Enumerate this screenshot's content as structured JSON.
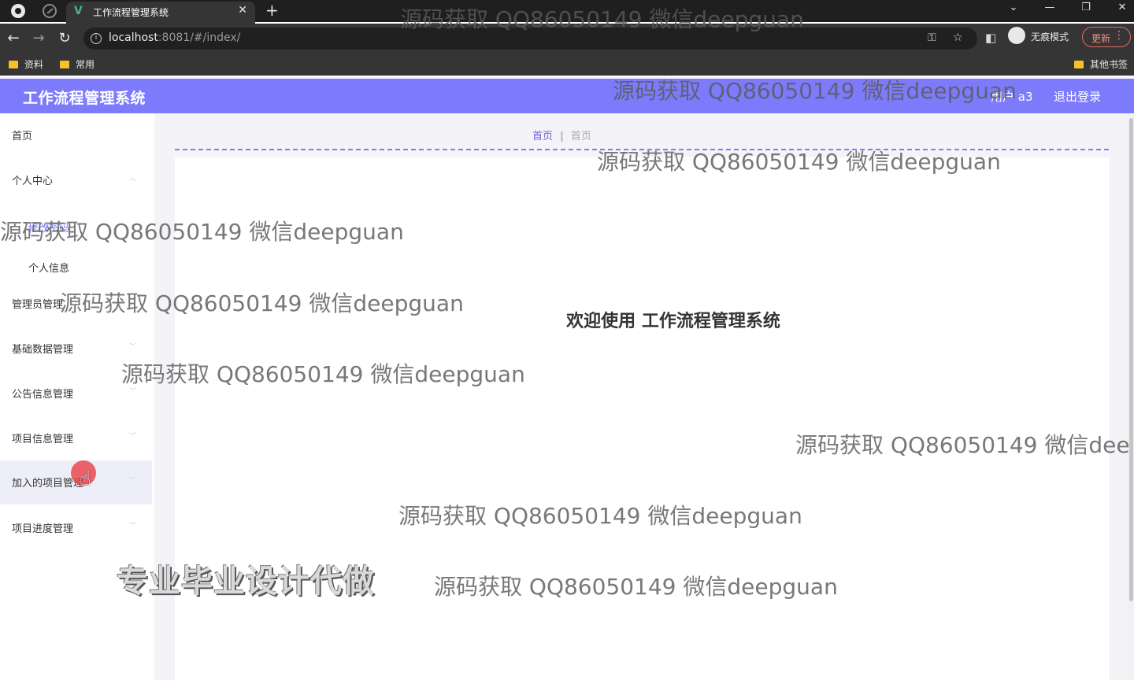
{
  "browser": {
    "tab_title": "工作流程管理系统",
    "tab_close": "✕",
    "new_tab": "+",
    "url_host": "localhost",
    "url_rest": ":8081/#/index/",
    "incognito_label": "无痕模式",
    "update_label": "更新",
    "bookmarks": [
      "资料",
      "常用"
    ],
    "other_bookmarks": "其他书签"
  },
  "app": {
    "title": "工作流程管理系统",
    "user": "用户 a3",
    "logout": "退出登录"
  },
  "sidebar": {
    "items": [
      {
        "label": "首页"
      },
      {
        "label": "个人中心"
      },
      {
        "label": "修改密码"
      },
      {
        "label": "个人信息"
      },
      {
        "label": "管理员管理"
      },
      {
        "label": "基础数据管理"
      },
      {
        "label": "公告信息管理"
      },
      {
        "label": "项目信息管理"
      },
      {
        "label": "加入的项目管理"
      },
      {
        "label": "项目进度管理"
      }
    ]
  },
  "breadcrumb": {
    "home": "首页",
    "current": "首页"
  },
  "main": {
    "welcome": "欢迎使用 工作流程管理系统"
  },
  "overlays": {
    "watermark": "源码获取 QQ86050149 微信deepguan",
    "watermark_cut": "源码获取 QQ86050149 微信dee",
    "promo": "专业毕业设计代做"
  }
}
